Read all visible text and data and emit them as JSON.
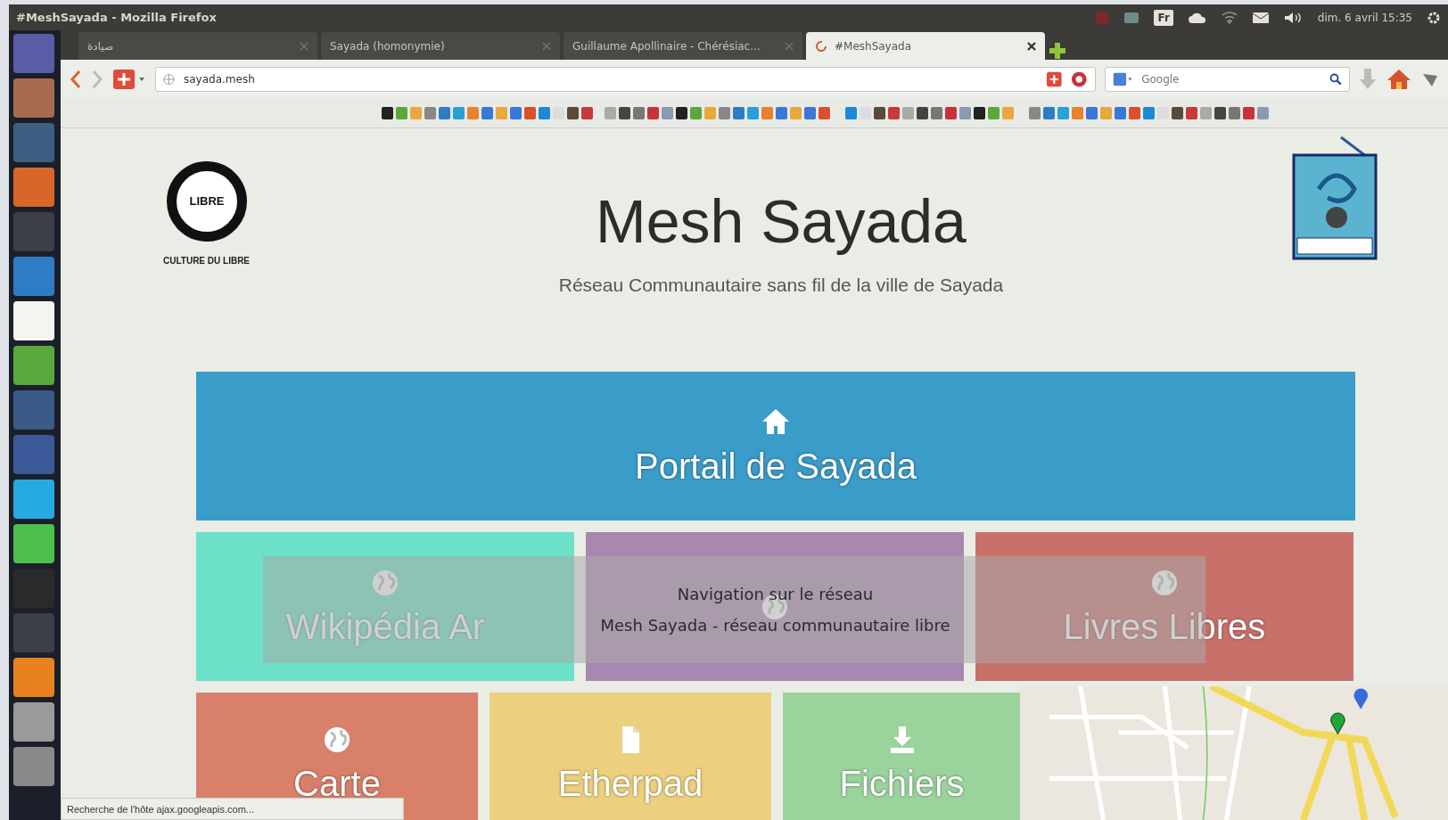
{
  "window": {
    "title": "#MeshSayada - Mozilla Firefox"
  },
  "top_panel": {
    "keyboard": "Fr",
    "clock": "dim. 6 avril 15:35"
  },
  "tabs": [
    {
      "label": "صيادة",
      "selected": false
    },
    {
      "label": "Sayada (homonymie)",
      "selected": false
    },
    {
      "label": "Guillaume Apollinaire - Chérésiac...",
      "selected": false
    },
    {
      "label": "#MeshSayada",
      "selected": true
    }
  ],
  "address_bar": {
    "value": "sayada.mesh"
  },
  "search": {
    "placeholder": "Google"
  },
  "page": {
    "left_logo": {
      "word": "LIBRE",
      "caption": "CULTURE DU LIBRE"
    },
    "title": "Mesh Sayada",
    "subtitle": "Réseau Communautaire sans fil de la ville de Sayada",
    "tiles": [
      [
        {
          "label": "Portail de Sayada",
          "kind": "home",
          "color": "#3a9cc8"
        }
      ],
      [
        {
          "label": "Wikipédia Ar",
          "kind": "globe",
          "color": "#6ce0c8"
        },
        {
          "kind": "globe",
          "color": "#a888b0"
        },
        {
          "label": "Livres Libres",
          "kind": "globe",
          "color": "#c8716b"
        }
      ],
      [
        {
          "label": "Carte",
          "kind": "globe",
          "color": "#d9806a"
        },
        {
          "label": "Etherpad",
          "kind": "file",
          "color": "#ecd07e"
        },
        {
          "label": "Fichiers",
          "kind": "download",
          "color": "#9bd39d"
        }
      ]
    ]
  },
  "caption_overlay": [
    "Navigation sur le réseau",
    "Mesh Sayada - réseau communautaire libre"
  ],
  "status_bar": "Recherche de l'hôte ajax.googleapis.com..."
}
